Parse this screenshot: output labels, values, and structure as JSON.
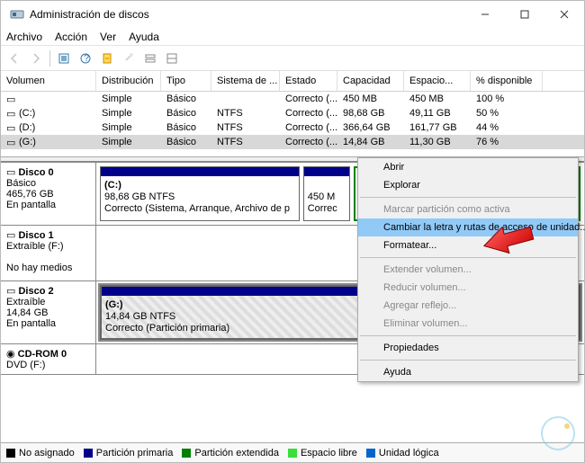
{
  "title": "Administración de discos",
  "menu": {
    "m0": "Archivo",
    "m1": "Acción",
    "m2": "Ver",
    "m3": "Ayuda"
  },
  "columns": {
    "c0": "Volumen",
    "c1": "Distribución",
    "c2": "Tipo",
    "c3": "Sistema de ...",
    "c4": "Estado",
    "c5": "Capacidad",
    "c6": "Espacio...",
    "c7": "% disponible"
  },
  "volumes": [
    {
      "v": "",
      "dist": "Simple",
      "tipo": "Básico",
      "fs": "",
      "est": "Correcto (...",
      "cap": "450 MB",
      "free": "450 MB",
      "pct": "100 %"
    },
    {
      "v": "(C:)",
      "dist": "Simple",
      "tipo": "Básico",
      "fs": "NTFS",
      "est": "Correcto (...",
      "cap": "98,68 GB",
      "free": "49,11 GB",
      "pct": "50 %"
    },
    {
      "v": "(D:)",
      "dist": "Simple",
      "tipo": "Básico",
      "fs": "NTFS",
      "est": "Correcto (...",
      "cap": "366,64 GB",
      "free": "161,77 GB",
      "pct": "44 %"
    },
    {
      "v": "(G:)",
      "dist": "Simple",
      "tipo": "Básico",
      "fs": "NTFS",
      "est": "Correcto (...",
      "cap": "14,84 GB",
      "free": "11,30 GB",
      "pct": "76 %"
    }
  ],
  "disks": {
    "d0": {
      "name": "Disco 0",
      "type": "Básico",
      "size": "465,76 GB",
      "status": "En pantalla",
      "p0": {
        "title": "(C:)",
        "line1": "98,68 GB NTFS",
        "line2": "Correcto (Sistema, Arranque, Archivo de p"
      },
      "p1": {
        "title": "",
        "line1": "450 M",
        "line2": "Correc"
      }
    },
    "d1": {
      "name": "Disco 1",
      "type": "Extraíble (F:)",
      "status": "No hay medios"
    },
    "d2": {
      "name": "Disco 2",
      "type": "Extraíble",
      "size": "14,84 GB",
      "status": "En pantalla",
      "p0": {
        "title": "(G:)",
        "line1": "14,84 GB NTFS",
        "line2": "Correcto (Partición primaria)"
      }
    },
    "cd": {
      "name": "CD-ROM 0",
      "type": "DVD (F:)"
    }
  },
  "legend": {
    "l0": "No asignado",
    "l1": "Partición primaria",
    "l2": "Partición extendida",
    "l3": "Espacio libre",
    "l4": "Unidad lógica"
  },
  "legend_colors": {
    "l0": "#000",
    "l1": "#00008b",
    "l2": "#008000",
    "l3": "#3adf3a",
    "l4": "#0066cc"
  },
  "ctx": {
    "i0": "Abrir",
    "i1": "Explorar",
    "i2": "Marcar partición como activa",
    "i3": "Cambiar la letra y rutas de acceso de unidad...",
    "i4": "Formatear...",
    "i5": "Extender volumen...",
    "i6": "Reducir volumen...",
    "i7": "Agregar reflejo...",
    "i8": "Eliminar volumen...",
    "i9": "Propiedades",
    "i10": "Ayuda"
  }
}
